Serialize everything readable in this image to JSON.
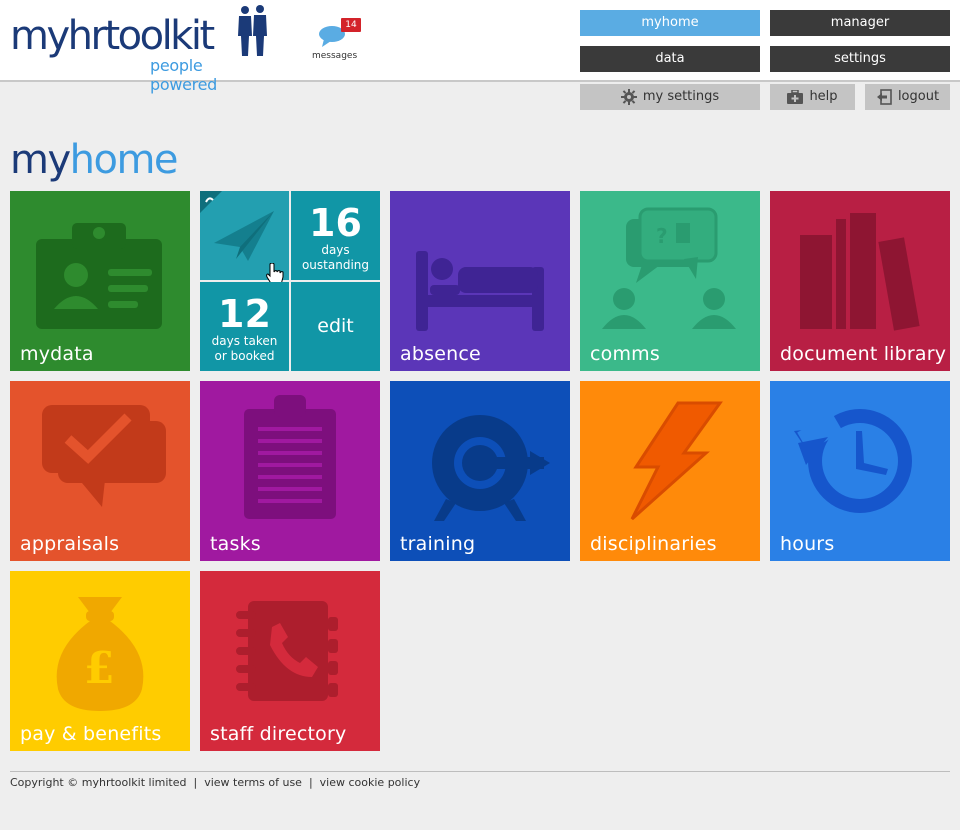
{
  "brand": {
    "logo_text_my": "my",
    "logo_text_hr": "hr",
    "logo_text_toolkit": "toolkit",
    "tagline": "people powered",
    "colors": {
      "navy": "#1b3a78",
      "sky": "#3d9be0"
    }
  },
  "messages": {
    "label": "messages",
    "count": "14",
    "icon": "speech-bubble-icon"
  },
  "nav": {
    "myhome": "myhome",
    "manager": "manager",
    "data": "data",
    "settings": "settings"
  },
  "subnav": {
    "my_settings": "my settings",
    "help": "help",
    "logout": "logout"
  },
  "page_title": {
    "my": "my",
    "home": "home"
  },
  "tiles": {
    "mydata": "mydata",
    "absence": "absence",
    "comms": "comms",
    "document_library": "document library",
    "appraisals": "appraisals",
    "tasks": "tasks",
    "training": "training",
    "disciplinaries": "disciplinaries",
    "hours": "hours",
    "pay_benefits": "pay & benefits",
    "staff_directory": "staff directory"
  },
  "holiday": {
    "outstanding_value": "16",
    "outstanding_label_1": "days",
    "outstanding_label_2": "oustanding",
    "taken_value": "12",
    "taken_label_1": "days taken",
    "taken_label_2": "or booked",
    "edit_label": "edit",
    "icon": "paper-plane-icon"
  },
  "footer": {
    "copyright": "Copyright © myhrtoolkit limited",
    "sep1": "|",
    "terms": "view terms of use",
    "sep2": "|",
    "cookie": "view cookie policy"
  }
}
